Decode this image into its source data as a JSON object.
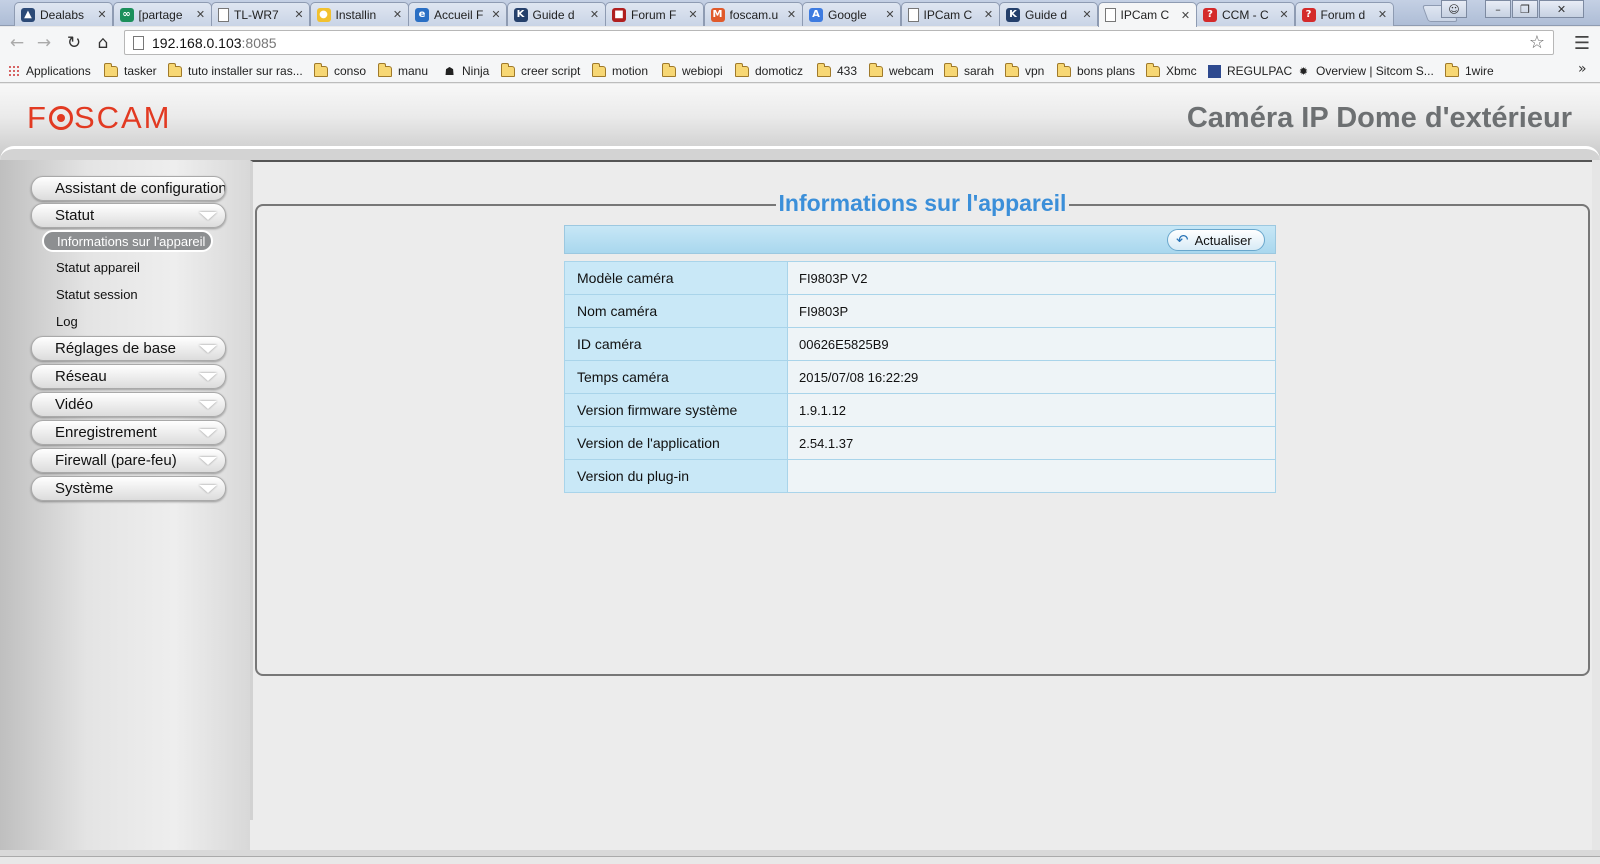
{
  "browser": {
    "tabs": [
      {
        "title": "Dealabs",
        "icon": "dealabs-icon",
        "color": "#2c4a77"
      },
      {
        "title": "[partage",
        "icon": "infinity-icon",
        "color": "#1b8f5a"
      },
      {
        "title": "TL-WR7",
        "icon": "page-icon",
        "color": "#ffffff"
      },
      {
        "title": "Installin",
        "icon": "lightbulb-icon",
        "color": "#f2c12e"
      },
      {
        "title": "Accueil F",
        "icon": "e-icon",
        "color": "#2a6fc4"
      },
      {
        "title": "Guide d",
        "icon": "k-icon",
        "color": "#25406b"
      },
      {
        "title": "Forum F",
        "icon": "forum-icon",
        "color": "#b01f1f"
      },
      {
        "title": "foscam.u",
        "icon": "magento-icon",
        "color": "#e05a2b"
      },
      {
        "title": "Google",
        "icon": "translate-icon",
        "color": "#3d7be0"
      },
      {
        "title": "IPCam C",
        "icon": "page-icon",
        "color": "#ffffff"
      },
      {
        "title": "Guide d",
        "icon": "k-icon",
        "color": "#25406b"
      },
      {
        "title": "IPCam C",
        "icon": "page-icon",
        "color": "#ffffff",
        "active": true
      },
      {
        "title": "CCM - C",
        "icon": "help-icon",
        "color": "#d42a2a"
      },
      {
        "title": "Forum d",
        "icon": "help-icon",
        "color": "#d42a2a"
      }
    ],
    "url_host": "192.168.0.103",
    "url_port": ":8085",
    "bookmarks": [
      {
        "label": "Applications",
        "type": "apps"
      },
      {
        "label": "tasker",
        "type": "folder"
      },
      {
        "label": "tuto installer sur ras...",
        "type": "folder"
      },
      {
        "label": "conso",
        "type": "folder"
      },
      {
        "label": "manu",
        "type": "folder"
      },
      {
        "label": "Ninja",
        "type": "ninja"
      },
      {
        "label": "creer script",
        "type": "folder"
      },
      {
        "label": "motion",
        "type": "folder"
      },
      {
        "label": "webiopi",
        "type": "folder"
      },
      {
        "label": "domoticz",
        "type": "folder"
      },
      {
        "label": "433",
        "type": "folder"
      },
      {
        "label": "webcam",
        "type": "folder"
      },
      {
        "label": "sarah",
        "type": "folder"
      },
      {
        "label": "vpn",
        "type": "folder"
      },
      {
        "label": "bons plans",
        "type": "folder"
      },
      {
        "label": "Xbmc",
        "type": "folder"
      },
      {
        "label": "REGULPAC",
        "type": "regulpac"
      },
      {
        "label": "Overview | Sitcom S...",
        "type": "sitcom"
      },
      {
        "label": "1wire",
        "type": "folder"
      }
    ]
  },
  "app": {
    "logo": "FOSCAM",
    "title": "Caméra IP Dome d'extérieur"
  },
  "sidebar": {
    "menus": [
      {
        "label": "Assistant de configuration",
        "has_chevron": false
      },
      {
        "label": "Statut",
        "has_chevron": true
      },
      {
        "label": "Réglages de base",
        "has_chevron": true
      },
      {
        "label": "Réseau",
        "has_chevron": true
      },
      {
        "label": "Vidéo",
        "has_chevron": true
      },
      {
        "label": "Enregistrement",
        "has_chevron": true
      },
      {
        "label": "Firewall (pare-feu)",
        "has_chevron": true
      },
      {
        "label": "Système",
        "has_chevron": true
      }
    ],
    "status_submenu": [
      {
        "label": "Informations sur l'appareil",
        "active": true
      },
      {
        "label": "Statut appareil"
      },
      {
        "label": "Statut session"
      },
      {
        "label": "Log"
      }
    ]
  },
  "main": {
    "panel_title": "Informations sur l'appareil",
    "refresh_label": "Actualiser",
    "rows": [
      {
        "key": "Modèle caméra",
        "value": "FI9803P V2"
      },
      {
        "key": "Nom caméra",
        "value": "FI9803P"
      },
      {
        "key": "ID caméra",
        "value": "00626E5825B9"
      },
      {
        "key": "Temps caméra",
        "value": "2015/07/08 16:22:29"
      },
      {
        "key": "Version firmware système",
        "value": "1.9.1.12"
      },
      {
        "key": "Version de l'application",
        "value": "2.54.1.37"
      },
      {
        "key": "Version du plug-in",
        "value": ""
      }
    ]
  },
  "colors": {
    "brand": "#e23a22",
    "title_blue": "#3b8fd9",
    "table_key_bg": "#c9e8f7"
  }
}
